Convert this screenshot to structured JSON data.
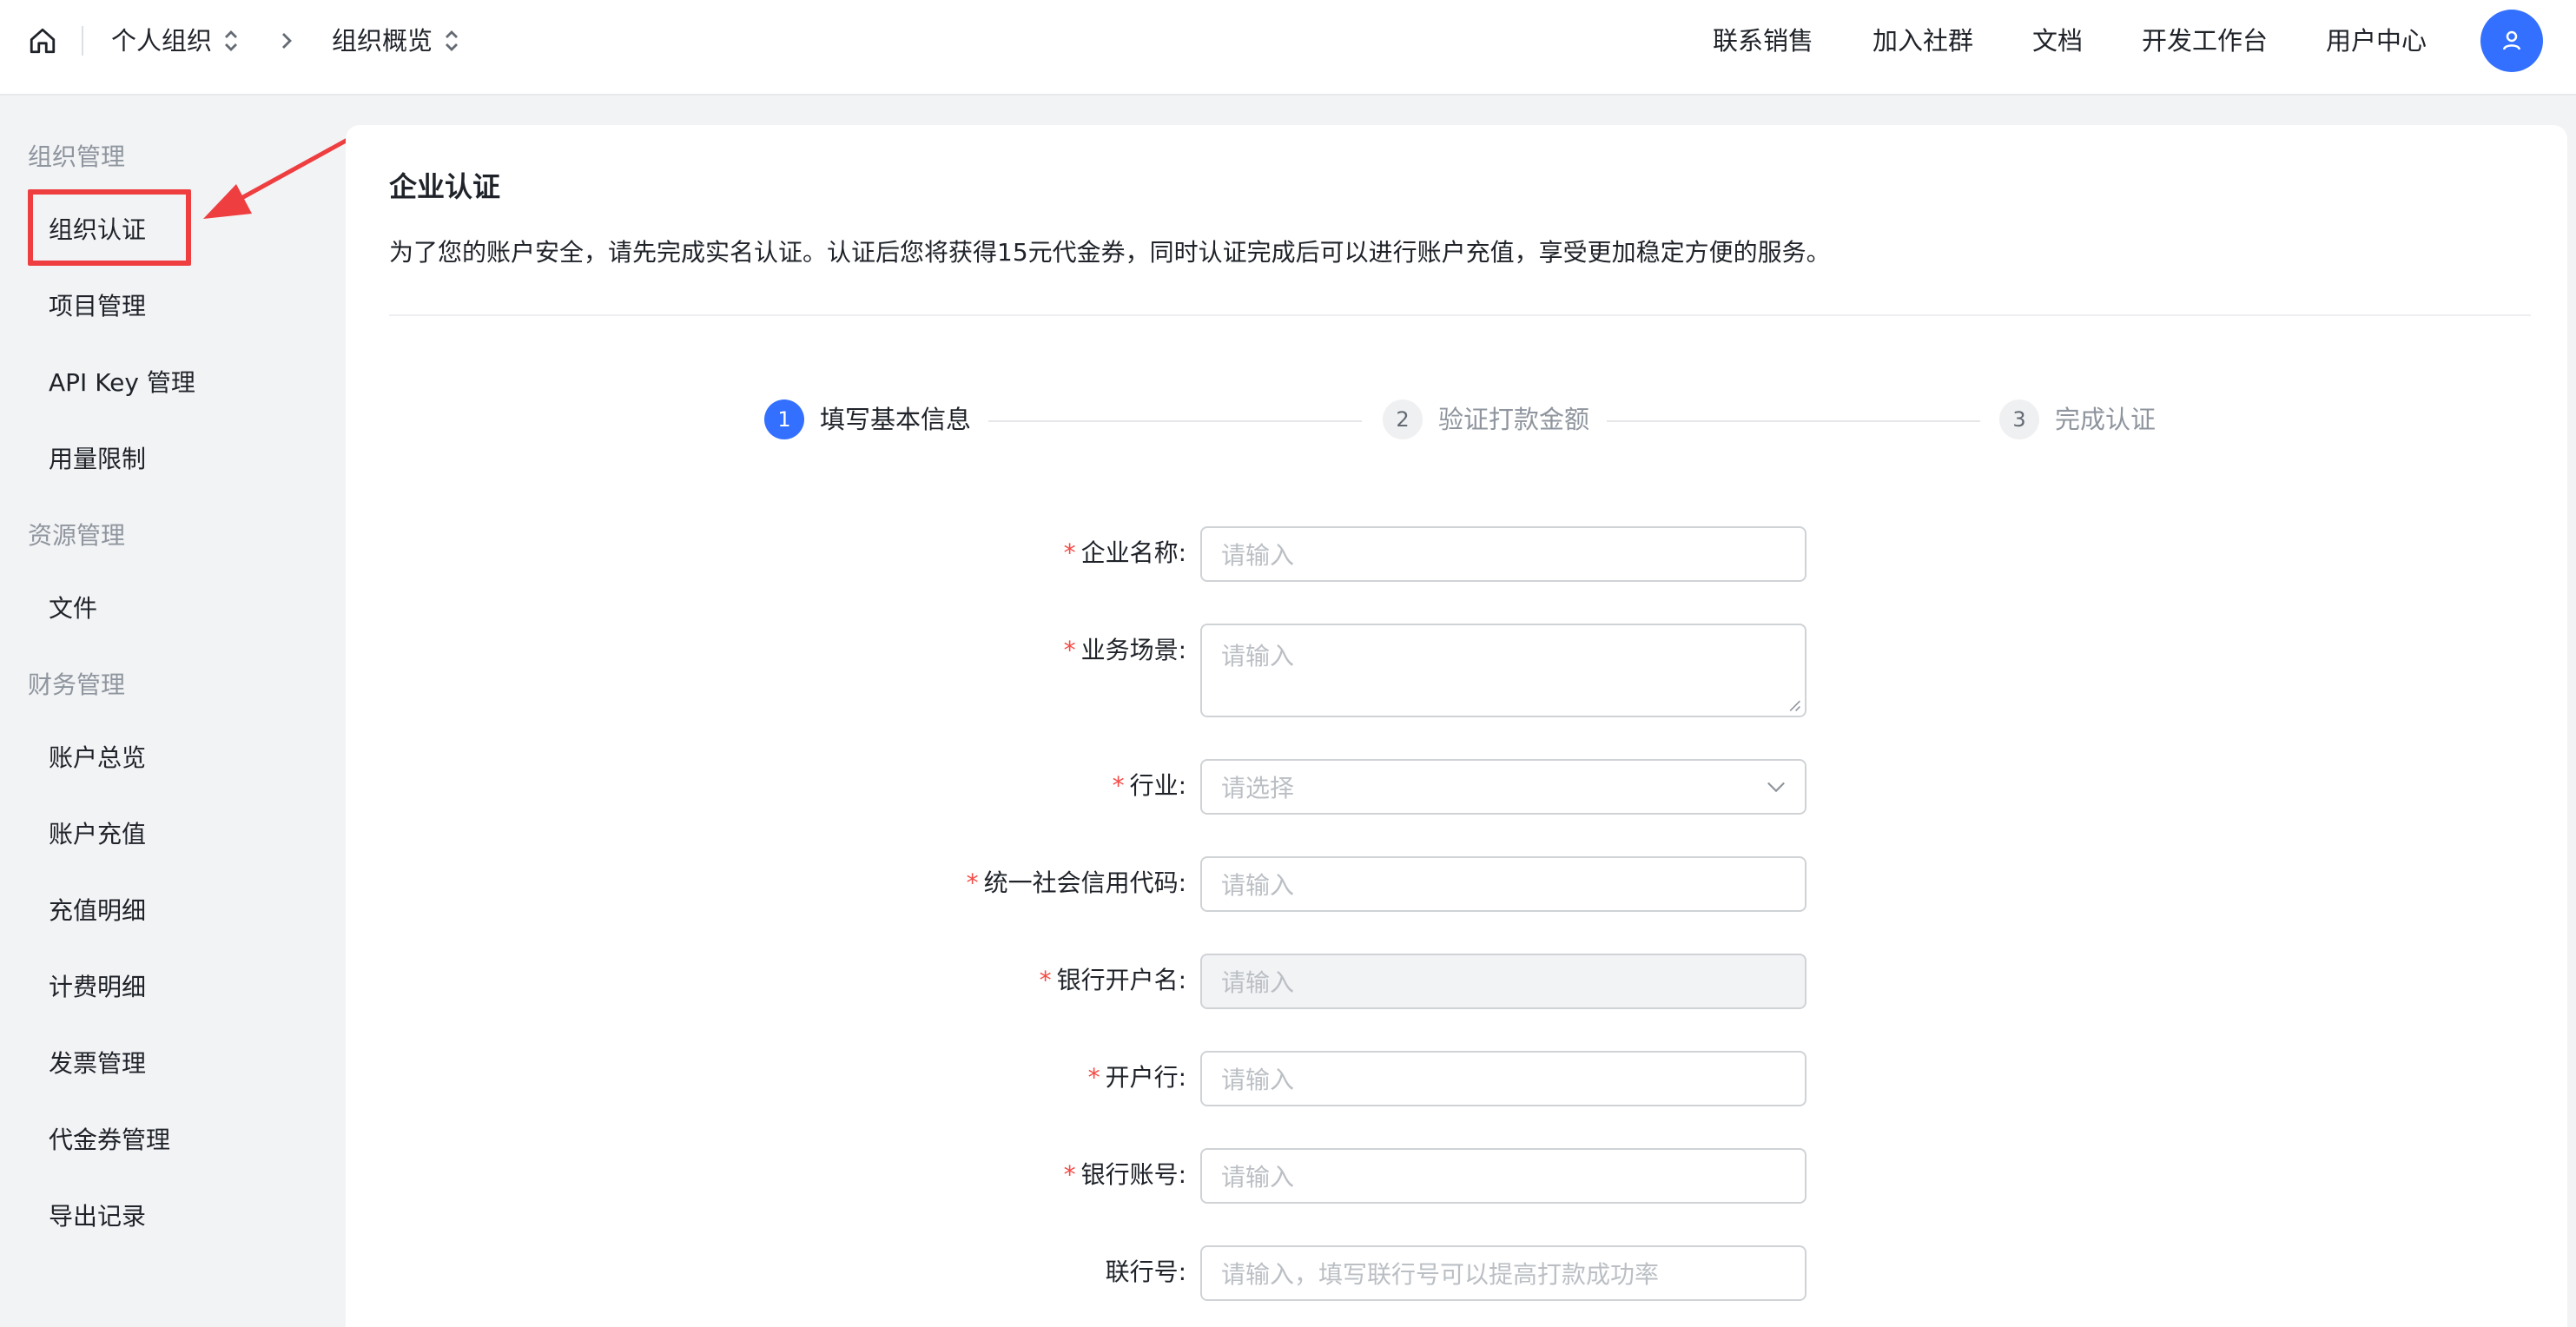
{
  "header": {
    "org_selector": "个人组织",
    "page_selector": "组织概览",
    "nav": [
      "联系销售",
      "加入社群",
      "文档",
      "开发工作台",
      "用户中心"
    ]
  },
  "sidebar": {
    "groups": [
      {
        "title": "组织管理",
        "items": [
          "组织认证",
          "项目管理",
          "API Key 管理",
          "用量限制"
        ]
      },
      {
        "title": "资源管理",
        "items": [
          "文件"
        ]
      },
      {
        "title": "财务管理",
        "items": [
          "账户总览",
          "账户充值",
          "充值明细",
          "计费明细",
          "发票管理",
          "代金券管理",
          "导出记录"
        ]
      }
    ]
  },
  "main": {
    "title": "企业认证",
    "description": "为了您的账户安全，请先完成实名认证。认证后您将获得15元代金券，同时认证完成后可以进行账户充值，享受更加稳定方便的服务。",
    "steps": [
      {
        "num": "1",
        "label": "填写基本信息",
        "status": "active"
      },
      {
        "num": "2",
        "label": "验证打款金额",
        "status": "pending"
      },
      {
        "num": "3",
        "label": "完成认证",
        "status": "pending"
      }
    ],
    "form": {
      "company_name": {
        "label": "企业名称:",
        "placeholder": "请输入"
      },
      "business_scenario": {
        "label": "业务场景:",
        "placeholder": "请输入"
      },
      "industry": {
        "label": "行业:",
        "placeholder": "请选择"
      },
      "credit_code": {
        "label": "统一社会信用代码:",
        "placeholder": "请输入"
      },
      "account_name": {
        "label": "银行开户名:",
        "placeholder": "请输入"
      },
      "bank": {
        "label": "开户行:",
        "placeholder": "请输入"
      },
      "account_number": {
        "label": "银行账号:",
        "placeholder": "请输入"
      },
      "bank_code": {
        "label": "联行号:",
        "placeholder": "请输入，填写联行号可以提高打款成功率"
      }
    },
    "required_mark": "*"
  },
  "colors": {
    "primary": "#3370ff",
    "required": "#f54a45",
    "annotation": "#ee3e40"
  }
}
